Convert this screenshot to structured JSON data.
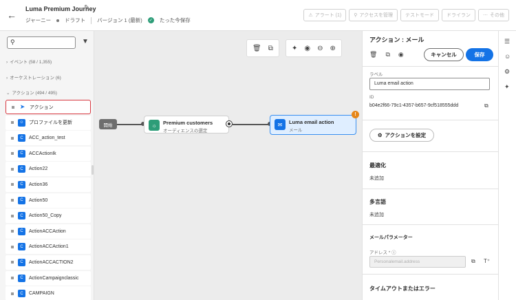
{
  "header": {
    "title": "Luma Premium Journey",
    "meta": {
      "type": "ジャーニー",
      "status": "ドラフト",
      "version": "バージョン 1 (最新)",
      "saved": "たった今保存"
    },
    "buttons": [
      {
        "label": "アラート (1)",
        "icon": "alert-icon"
      },
      {
        "label": "アクセスを管理",
        "icon": "key-icon"
      },
      {
        "label": "テストモード",
        "icon": ""
      },
      {
        "label": "ドライラン",
        "icon": ""
      },
      {
        "label": "その他",
        "icon": "more-icon"
      }
    ]
  },
  "left_panel": {
    "search_placeholder": "",
    "categories": [
      {
        "label": "イベント (58 / 1,355)",
        "expanded": false
      },
      {
        "label": "オーケストレーション (6)",
        "expanded": false
      },
      {
        "label": "アクション (494 / 495)",
        "expanded": true
      }
    ],
    "items": [
      {
        "label": "アクション",
        "icon": "send-icon"
      },
      {
        "label": "プロファイルを更新",
        "icon": "profile-icon"
      },
      {
        "label": "ACC_action_test",
        "icon": "custom-action-icon"
      },
      {
        "label": "ACCActionIk",
        "icon": "custom-action-icon"
      },
      {
        "label": "Action22",
        "icon": "custom-action-icon"
      },
      {
        "label": "Action36",
        "icon": "custom-action-icon"
      },
      {
        "label": "Action50",
        "icon": "custom-action-icon"
      },
      {
        "label": "Action50_Copy",
        "icon": "custom-action-icon"
      },
      {
        "label": "ActionACCAction",
        "icon": "custom-action-icon"
      },
      {
        "label": "ActionACCAction1",
        "icon": "custom-action-icon"
      },
      {
        "label": "ActionACCACTION2",
        "icon": "custom-action-icon"
      },
      {
        "label": "ActionCampaignclassic",
        "icon": "custom-action-icon"
      },
      {
        "label": "CAMPAIGN",
        "icon": "custom-action-icon"
      }
    ]
  },
  "canvas": {
    "start_label": "開始",
    "nodes": [
      {
        "title": "Premium customers",
        "subtitle": "オーディエンスの選定",
        "color": "#2d9d78"
      },
      {
        "title": "Luma email action",
        "subtitle": "メール",
        "color": "#1473e6"
      }
    ],
    "warning_badge": "!"
  },
  "right_panel": {
    "title": "アクション : メール",
    "cancel_label": "キャンセル",
    "save_label": "保存",
    "label_field": {
      "label": "ラベル",
      "value": "Luma email action"
    },
    "id_label": "ID",
    "id_value": "b04e2f66-79c1-4357-b657-9cf518555ddd",
    "configure_label": "アクションを設定",
    "optimization": {
      "title": "最適化",
      "value": "未追加"
    },
    "multilang": {
      "title": "多言語",
      "value": "未追加"
    },
    "email_params": {
      "title": "メールパラメーター",
      "address_label": "アドレス *",
      "address_placeholder": "Personalemail.address"
    },
    "timeout_title": "タイムアウトまたはエラー"
  },
  "colors": {
    "accent": "#1473e6",
    "selected_border": "#d7373f",
    "warning": "#e68619",
    "success": "#2d9d78"
  }
}
